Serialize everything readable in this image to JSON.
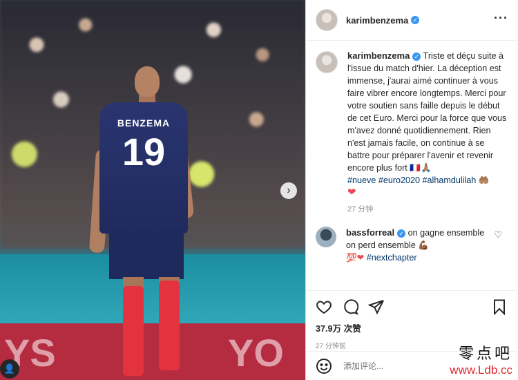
{
  "post": {
    "username": "karimbenzema",
    "more_label": "···",
    "photo": {
      "jersey_name": "BENZEMA",
      "jersey_number": "19",
      "board_text": "YS",
      "board_text2": "YO"
    },
    "caption": {
      "username": "karimbenzema",
      "text": "Triste et déçu suite à l'issue du match d'hier. La déception est immense, j'aurai aimé continuer à vous faire vibrer encore longtemps. Merci pour votre soutien sans faille depuis le début de cet Euro. Merci pour la force que vous m'avez donné quotidiennement. Rien n'est jamais facile, on continue à se battre pour préparer l'avenir et revenir encore plus fort 🇫🇷🙏🏽",
      "hashtags": "#nueve #euro2020 #alhamdulilah 🤲🏽",
      "heart": "❤",
      "time": "27 分钟"
    },
    "reply": {
      "username": "bassforreal",
      "text": "on gagne ensemble on perd ensemble 💪🏾",
      "tail_emoji": "💯❤",
      "hashtag": "#nextchapter",
      "like_icon": "♡"
    },
    "likes": "37.9万 次赞",
    "timestamp": "27 分钟前",
    "comment_placeholder": "添加评论...",
    "watermark_cn": "零点吧",
    "watermark_url": "www.Ldb.cc",
    "user_badge": "👤",
    "nav_next": "›"
  }
}
